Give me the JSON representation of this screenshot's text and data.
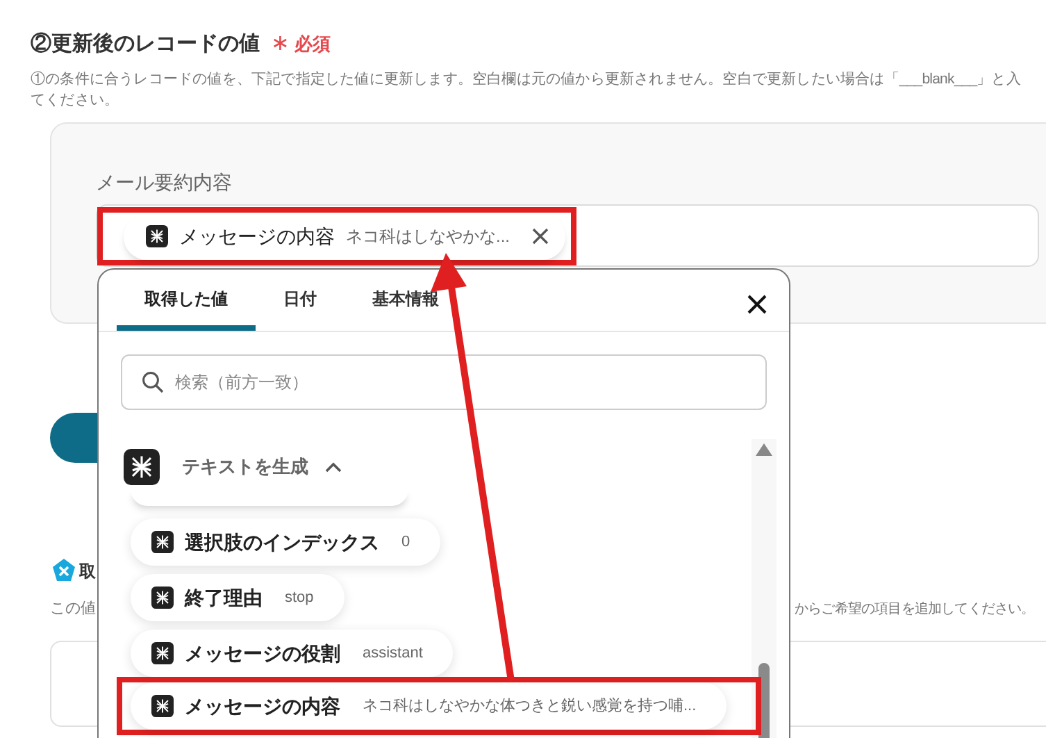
{
  "section": {
    "title": "②更新後のレコードの値",
    "required_mark": "∗",
    "required": "必須",
    "description_lines": [
      "①の条件に合うレコードの値を、下記で指定した値に更新します。空白欄は元の値から更新されません。空白で更新したい場合は「___blank___」と入",
      "てください。"
    ]
  },
  "field": {
    "label": "メール要約内容",
    "chip": {
      "name": "メッセージの内容",
      "value": "ネコ科はしなやかな...",
      "highlighted": true
    }
  },
  "background": {
    "next_title": "取",
    "help_left": "この値",
    "help_right": "からご希望の項目を追加してください。"
  },
  "popup": {
    "tabs": [
      {
        "label": "取得した値",
        "selected": true
      },
      {
        "label": "日付",
        "selected": false
      },
      {
        "label": "基本情報",
        "selected": false
      }
    ],
    "search": {
      "placeholder": "検索（前方一致）"
    },
    "group": {
      "title": "テキストを生成",
      "expanded": true
    },
    "items": [
      {
        "name": "選択肢のインデックス",
        "value": "0",
        "highlighted": false
      },
      {
        "name": "終了理由",
        "value": "stop",
        "highlighted": false
      },
      {
        "name": "メッセージの役割",
        "value": "assistant",
        "highlighted": false
      },
      {
        "name": "メッセージの内容",
        "value": "ネコ科はしなやかな体つきと鋭い感覚を持つ哺...",
        "highlighted": true
      }
    ]
  }
}
